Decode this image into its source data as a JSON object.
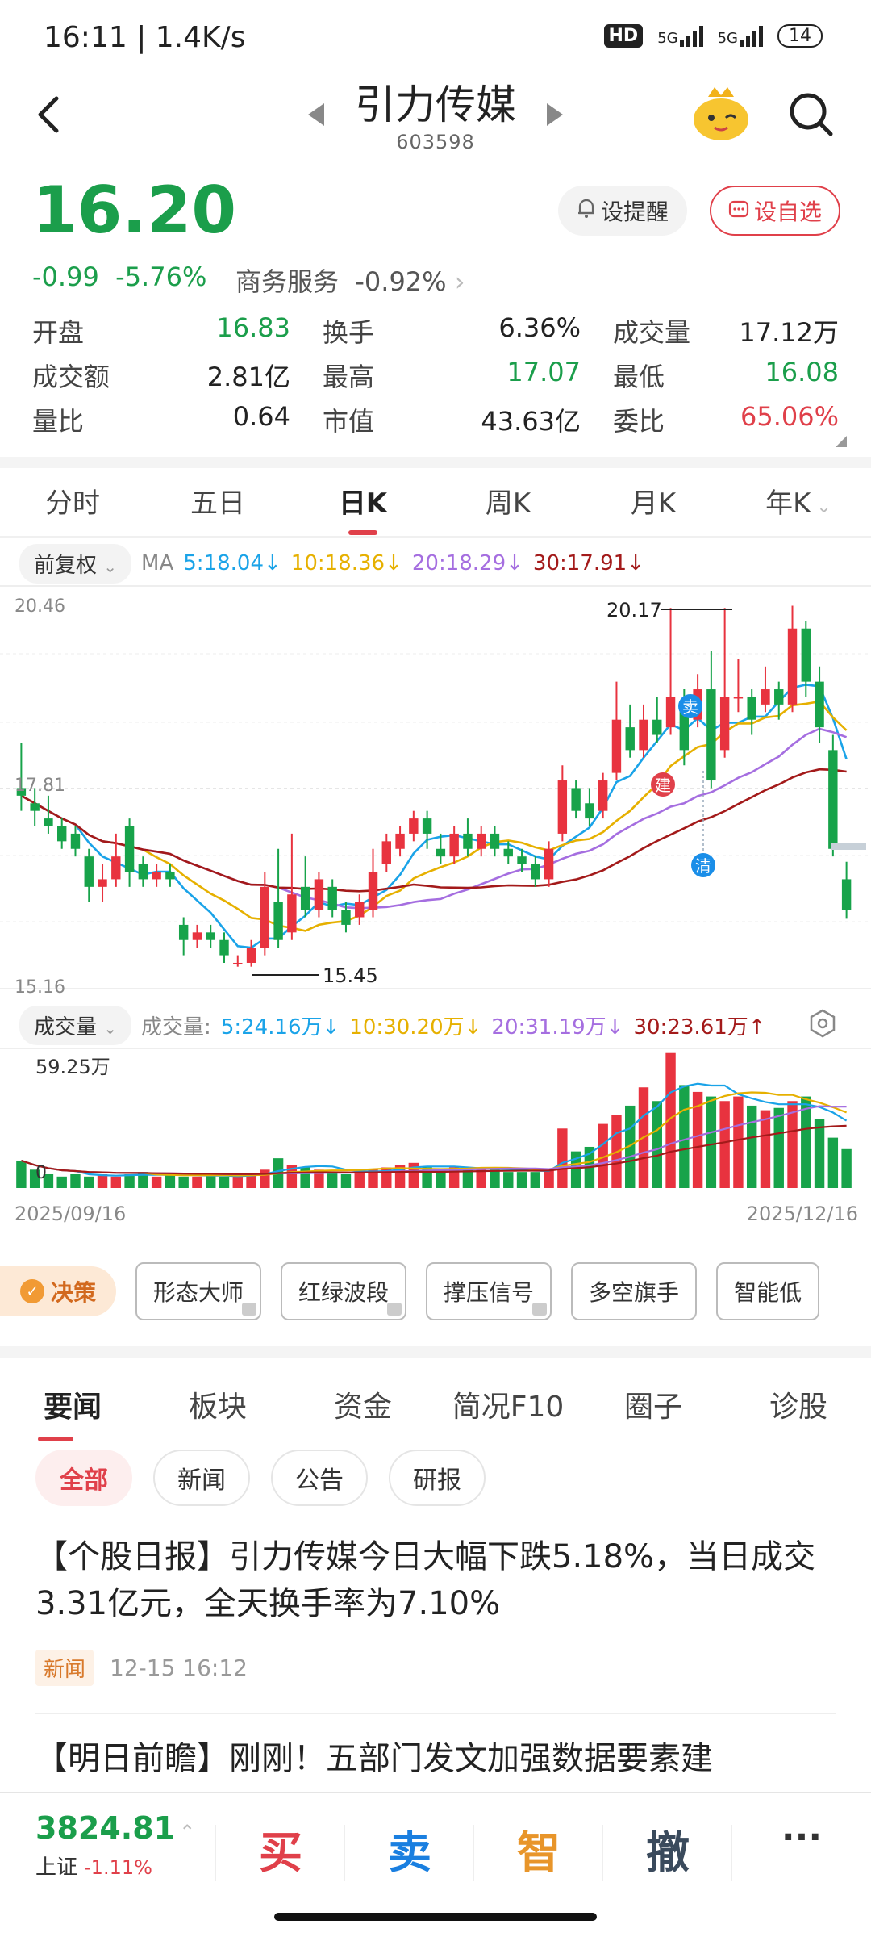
{
  "status": {
    "time": "16:11 | 1.4K/s",
    "hd": "HD",
    "net1": "5G",
    "net2": "5G",
    "battery": "14"
  },
  "header": {
    "name": "引力传媒",
    "code": "603598",
    "back_icon": "chevron-left-icon",
    "search_icon": "search-icon"
  },
  "quote": {
    "price": "16.20",
    "change": "-0.99",
    "change_pct": "-5.76%",
    "sector": "商务服务",
    "sector_pct": "-0.92%",
    "remind_label": "设提醒",
    "watch_label": "设自选"
  },
  "stats": {
    "open_k": "开盘",
    "open_v": "16.83",
    "turnover_k": "换手",
    "turnover_v": "6.36%",
    "volume_k": "成交量",
    "volume_v": "17.12万",
    "amount_k": "成交额",
    "amount_v": "2.81亿",
    "high_k": "最高",
    "high_v": "17.07",
    "low_k": "最低",
    "low_v": "16.08",
    "ratio_k": "量比",
    "ratio_v": "0.64",
    "cap_k": "市值",
    "cap_v": "43.63亿",
    "bid_k": "委比",
    "bid_v": "65.06%"
  },
  "ktabs": [
    "分时",
    "五日",
    "日K",
    "周K",
    "月K",
    "年K"
  ],
  "ma": {
    "adjust": "前复权",
    "label": "MA",
    "ma5": "5:18.04↓",
    "ma10": "10:18.36↓",
    "ma20": "20:18.29↓",
    "ma30": "30:17.91↓",
    "colors": {
      "ma5": "#1aa3e8",
      "ma10": "#e6b000",
      "ma20": "#a56ee0",
      "ma30": "#a31a1a"
    }
  },
  "chart_data": {
    "type": "candlestick",
    "y_top": "20.46",
    "y_mid": "17.81",
    "y_bottom": "15.16",
    "high_label": "20.17",
    "low_label": "15.45",
    "ylim": [
      15.16,
      20.46
    ],
    "markers": {
      "sell": "卖",
      "build": "建",
      "clear": "清"
    },
    "candles": [
      {
        "o": 17.8,
        "c": 17.7,
        "h": 18.4,
        "l": 17.5
      },
      {
        "o": 17.6,
        "c": 17.5,
        "h": 17.8,
        "l": 17.3
      },
      {
        "o": 17.4,
        "c": 17.3,
        "h": 17.7,
        "l": 17.2
      },
      {
        "o": 17.3,
        "c": 17.1,
        "h": 17.4,
        "l": 17.0
      },
      {
        "o": 17.2,
        "c": 17.0,
        "h": 17.3,
        "l": 16.9
      },
      {
        "o": 16.9,
        "c": 16.5,
        "h": 17.0,
        "l": 16.3
      },
      {
        "o": 16.5,
        "c": 16.6,
        "h": 16.8,
        "l": 16.3
      },
      {
        "o": 16.6,
        "c": 16.9,
        "h": 17.2,
        "l": 16.5
      },
      {
        "o": 17.3,
        "c": 16.7,
        "h": 17.4,
        "l": 16.5
      },
      {
        "o": 16.8,
        "c": 16.6,
        "h": 16.9,
        "l": 16.5
      },
      {
        "o": 16.6,
        "c": 16.7,
        "h": 16.8,
        "l": 16.5
      },
      {
        "o": 16.7,
        "c": 16.6,
        "h": 16.8,
        "l": 16.5
      },
      {
        "o": 16.0,
        "c": 15.8,
        "h": 16.1,
        "l": 15.6
      },
      {
        "o": 15.8,
        "c": 15.9,
        "h": 16.0,
        "l": 15.7
      },
      {
        "o": 15.9,
        "c": 15.8,
        "h": 16.0,
        "l": 15.7
      },
      {
        "o": 15.8,
        "c": 15.6,
        "h": 15.9,
        "l": 15.5
      },
      {
        "o": 15.5,
        "c": 15.5,
        "h": 15.6,
        "l": 15.45
      },
      {
        "o": 15.5,
        "c": 15.7,
        "h": 15.8,
        "l": 15.45
      },
      {
        "o": 15.7,
        "c": 16.5,
        "h": 16.7,
        "l": 15.6
      },
      {
        "o": 16.3,
        "c": 15.8,
        "h": 17.0,
        "l": 15.7
      },
      {
        "o": 15.9,
        "c": 16.4,
        "h": 17.2,
        "l": 15.8
      },
      {
        "o": 16.5,
        "c": 16.2,
        "h": 16.9,
        "l": 16.1
      },
      {
        "o": 16.2,
        "c": 16.6,
        "h": 16.7,
        "l": 16.1
      },
      {
        "o": 16.5,
        "c": 16.2,
        "h": 16.6,
        "l": 16.1
      },
      {
        "o": 16.2,
        "c": 16.0,
        "h": 16.3,
        "l": 15.9
      },
      {
        "o": 16.1,
        "c": 16.3,
        "h": 16.4,
        "l": 16.0
      },
      {
        "o": 16.2,
        "c": 16.7,
        "h": 17.0,
        "l": 16.1
      },
      {
        "o": 16.8,
        "c": 17.1,
        "h": 17.2,
        "l": 16.7
      },
      {
        "o": 17.0,
        "c": 17.2,
        "h": 17.3,
        "l": 16.9
      },
      {
        "o": 17.2,
        "c": 17.4,
        "h": 17.5,
        "l": 17.1
      },
      {
        "o": 17.4,
        "c": 17.2,
        "h": 17.5,
        "l": 17.0
      },
      {
        "o": 17.0,
        "c": 16.9,
        "h": 17.2,
        "l": 16.8
      },
      {
        "o": 16.9,
        "c": 17.2,
        "h": 17.3,
        "l": 16.8
      },
      {
        "o": 17.2,
        "c": 17.0,
        "h": 17.4,
        "l": 16.9
      },
      {
        "o": 17.0,
        "c": 17.2,
        "h": 17.3,
        "l": 16.9
      },
      {
        "o": 17.2,
        "c": 17.0,
        "h": 17.3,
        "l": 16.9
      },
      {
        "o": 17.0,
        "c": 16.9,
        "h": 17.1,
        "l": 16.8
      },
      {
        "o": 16.9,
        "c": 16.8,
        "h": 17.0,
        "l": 16.7
      },
      {
        "o": 16.8,
        "c": 16.6,
        "h": 16.9,
        "l": 16.5
      },
      {
        "o": 16.6,
        "c": 17.0,
        "h": 17.1,
        "l": 16.5
      },
      {
        "o": 17.2,
        "c": 17.9,
        "h": 18.1,
        "l": 17.1
      },
      {
        "o": 17.8,
        "c": 17.5,
        "h": 17.9,
        "l": 17.4
      },
      {
        "o": 17.6,
        "c": 17.4,
        "h": 17.8,
        "l": 17.3
      },
      {
        "o": 17.5,
        "c": 17.9,
        "h": 18.0,
        "l": 17.4
      },
      {
        "o": 18.0,
        "c": 18.7,
        "h": 19.2,
        "l": 17.9
      },
      {
        "o": 18.6,
        "c": 18.3,
        "h": 18.9,
        "l": 18.2
      },
      {
        "o": 18.3,
        "c": 18.7,
        "h": 18.9,
        "l": 18.2
      },
      {
        "o": 18.7,
        "c": 18.5,
        "h": 19.0,
        "l": 18.4
      },
      {
        "o": 18.6,
        "c": 19.0,
        "h": 20.17,
        "l": 18.5
      },
      {
        "o": 18.9,
        "c": 18.3,
        "h": 19.1,
        "l": 18.1
      },
      {
        "o": 18.7,
        "c": 19.1,
        "h": 19.3,
        "l": 18.6
      },
      {
        "o": 19.1,
        "c": 17.9,
        "h": 19.6,
        "l": 17.8
      },
      {
        "o": 18.3,
        "c": 19.0,
        "h": 20.17,
        "l": 18.2
      },
      {
        "o": 19.0,
        "c": 19.0,
        "h": 19.5,
        "l": 18.8
      },
      {
        "o": 19.0,
        "c": 18.7,
        "h": 19.1,
        "l": 18.5
      },
      {
        "o": 18.9,
        "c": 19.1,
        "h": 19.4,
        "l": 18.8
      },
      {
        "o": 19.1,
        "c": 18.9,
        "h": 19.2,
        "l": 18.7
      },
      {
        "o": 18.9,
        "c": 19.9,
        "h": 20.2,
        "l": 18.8
      },
      {
        "o": 19.9,
        "c": 19.2,
        "h": 20.0,
        "l": 19.0
      },
      {
        "o": 19.2,
        "c": 18.6,
        "h": 19.4,
        "l": 18.4
      },
      {
        "o": 18.3,
        "c": 17.0,
        "h": 18.5,
        "l": 16.9
      },
      {
        "o": 16.6,
        "c": 16.2,
        "h": 16.83,
        "l": 16.08
      }
    ]
  },
  "volume": {
    "label": "成交量",
    "prefix": "成交量:",
    "ma5": "5:24.16万↓",
    "ma10": "10:30.20万↓",
    "ma20": "20:31.19万↓",
    "ma30": "30:23.61万↑",
    "max_label": "59.25万",
    "zero": "0",
    "date_start": "2025/09/16",
    "date_end": "2025/12/16",
    "values": [
      12,
      8,
      6,
      5,
      6,
      5,
      6,
      5,
      6,
      7,
      5,
      6,
      5,
      5,
      6,
      5,
      5,
      6,
      8,
      13,
      10,
      9,
      8,
      7,
      6,
      7,
      8,
      9,
      10,
      11,
      9,
      8,
      9,
      8,
      9,
      8,
      7,
      7,
      7,
      8,
      26,
      16,
      18,
      28,
      32,
      36,
      44,
      38,
      59,
      45,
      42,
      40,
      38,
      40,
      36,
      34,
      35,
      38,
      40,
      30,
      22,
      17
    ]
  },
  "tools": {
    "juece": "决策",
    "items": [
      "形态大师",
      "红绿波段",
      "撑压信号",
      "多空旗手",
      "智能低"
    ]
  },
  "news_tabs": [
    "要闻",
    "板块",
    "资金",
    "简况F10",
    "圈子",
    "诊股"
  ],
  "filters": [
    "全部",
    "新闻",
    "公告",
    "研报"
  ],
  "news": [
    {
      "title": "【个股日报】引力传媒今日大幅下跌5.18%，当日成交3.31亿元，全天换手率为7.10%",
      "tag": "新闻",
      "time": "12-15 16:12"
    },
    {
      "title": "【明日前瞻】刚刚！五部门发文加强数据要素建"
    }
  ],
  "bottom": {
    "index_value": "3824.81",
    "index_name": "上证",
    "index_pct": "-1.11%",
    "buy": "买",
    "sell": "卖",
    "smart": "智",
    "cancel": "撤",
    "more": "···"
  }
}
